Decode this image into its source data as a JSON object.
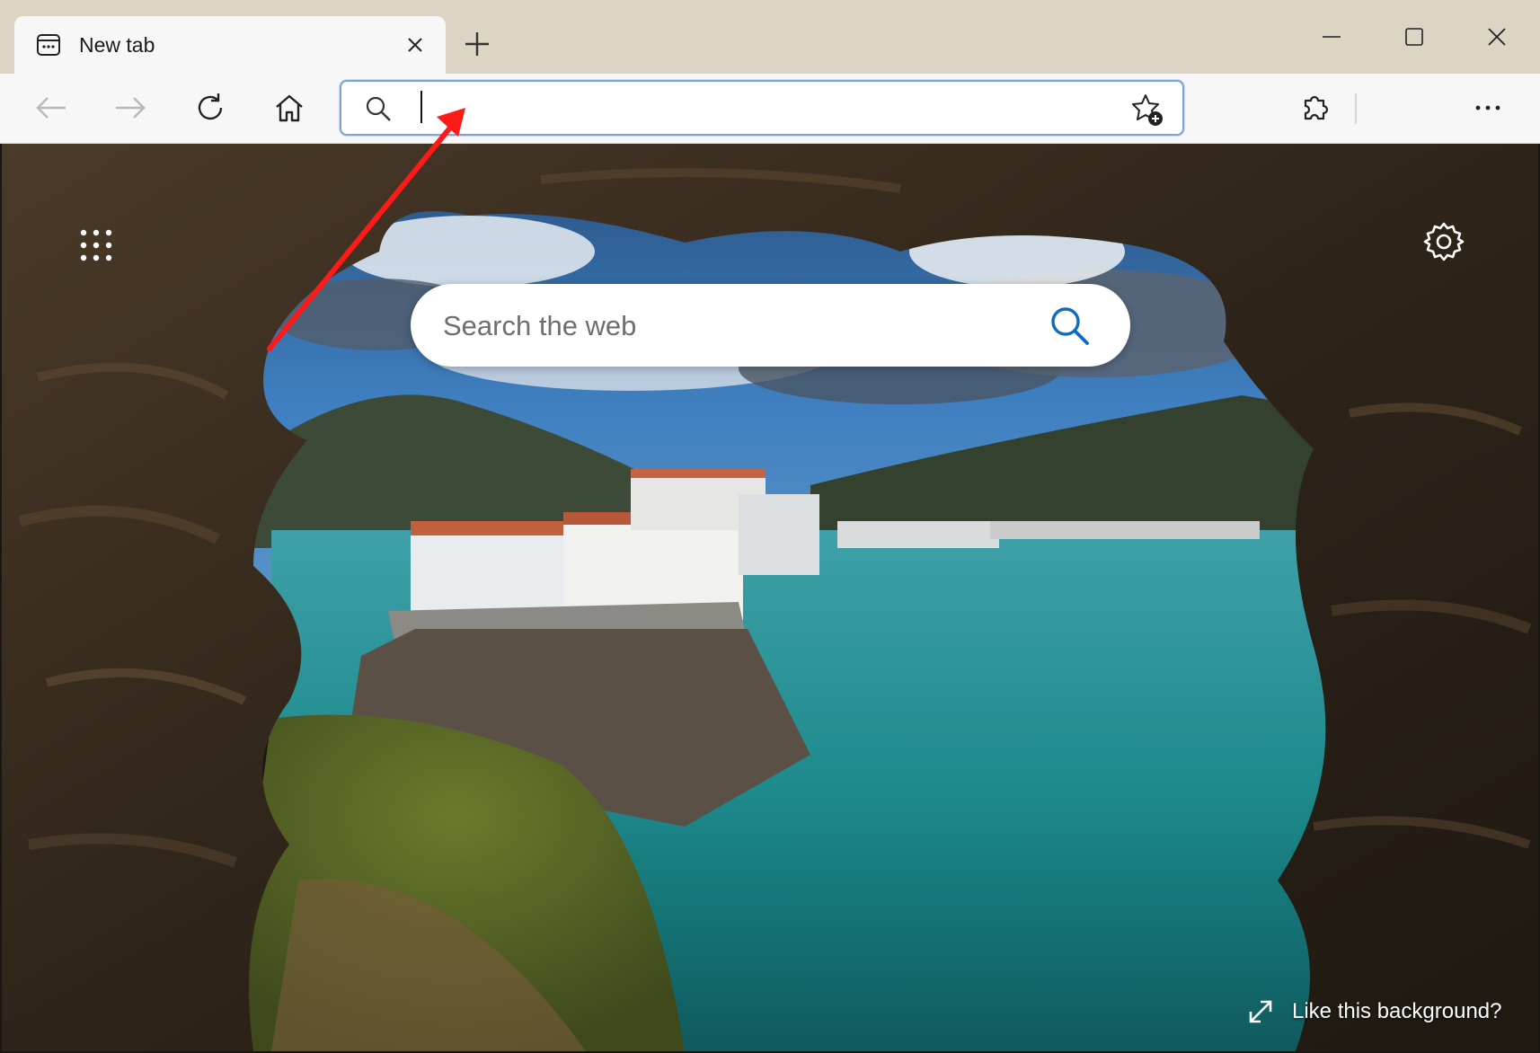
{
  "window": {
    "tab_title": "New tab",
    "new_tab_symbol": "+",
    "controls": [
      "minimize-icon",
      "maximize-icon",
      "close-icon"
    ]
  },
  "toolbar": {
    "address_value": "",
    "address_placeholder": "",
    "icons": [
      "back-arrow-icon",
      "forward-arrow-icon",
      "refresh-icon",
      "home-icon",
      "search-icon",
      "add-favorite-icon",
      "extensions-icon",
      "more-menu-icon"
    ]
  },
  "page": {
    "search_placeholder": "Search the web",
    "like_background_text": "Like this background?",
    "icons": [
      "apps-grid-icon",
      "settings-gear-icon",
      "expand-icon"
    ]
  },
  "colors": {
    "address_border": "#7ea3d6",
    "search_icon_blue": "#0f6cbd",
    "annotation_arrow": "#ff1a1a"
  }
}
